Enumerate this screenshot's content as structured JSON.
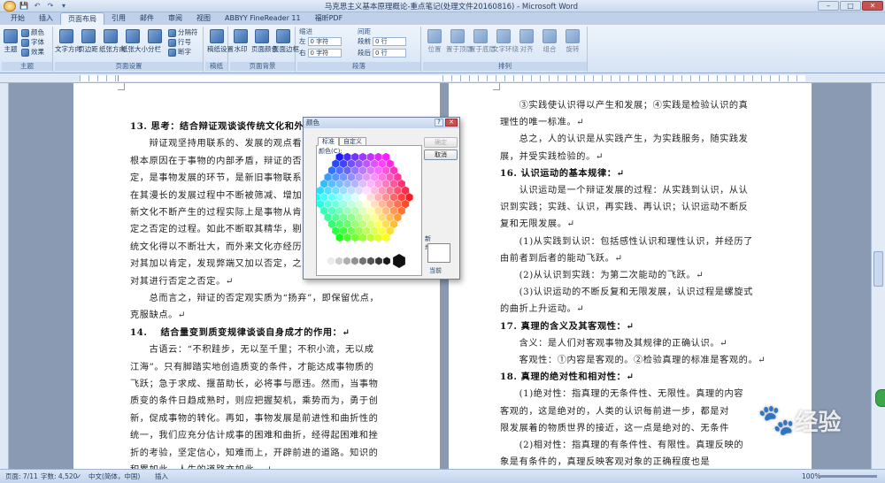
{
  "window": {
    "title": "马克思主义基本原理概论-重点笔记(处理文件20160816) - Microsoft Word",
    "min": "–",
    "max": "□",
    "close": "✕"
  },
  "tabs": [
    "开始",
    "插入",
    "页面布局",
    "引用",
    "邮件",
    "审阅",
    "视图",
    "ABBYY FineReader 11",
    "福昕PDF"
  ],
  "active_tab": "页面布局",
  "ribbon": {
    "theme": {
      "main": "主题",
      "colors": "颜色",
      "fonts": "字体",
      "effects": "效果",
      "label": "主题"
    },
    "page_setup": {
      "items": [
        "文字方向",
        "页边距",
        "纸张方向",
        "纸张大小",
        "分栏"
      ],
      "breaks": "分隔符",
      "line_numbers": "行号",
      "hyphenation": "断字",
      "label": "页面设置"
    },
    "manuscript": {
      "item": "稿纸设置",
      "label": "稿纸"
    },
    "background": {
      "items": [
        "水印",
        "页面颜色",
        "页面边框"
      ],
      "label": "页面背景"
    },
    "paragraph": {
      "indent": "缩进",
      "spacing": "间距",
      "left": "左",
      "right": "右",
      "before": "段前",
      "after": "段后",
      "left_val": "0 字符",
      "right_val": "0 字符",
      "before_val": "0 行",
      "after_val": "0 行",
      "label": "段落"
    },
    "arrange": {
      "items": [
        "位置",
        "置于顶层",
        "置于底层",
        "文字环绕",
        "对齐",
        "组合",
        "旋转"
      ],
      "label": "排列"
    }
  },
  "page1_lines": [
    {
      "t": "13. 思考：结合辩证观谈谈传统文化和外",
      "b": true
    },
    {
      "t": "　　辩证观坚持用联系的、发展的观点看",
      "b": false
    },
    {
      "t": "根本原因在于事物的内部矛盾，辩证的否",
      "b": false
    },
    {
      "t": "定，是事物发展的环节，是新旧事物联系",
      "b": false
    },
    {
      "t": "在其漫长的发展过程中不断被筛减、增加",
      "b": false
    },
    {
      "t": "新文化不断产生的过程实际上是事物从肯",
      "b": false
    },
    {
      "t": "定之否定的过程。如此不断取其精华，剔",
      "b": false
    },
    {
      "t": "统文化得以不断壮大，而外来文化亦经历",
      "b": false
    },
    {
      "t": "对其加以肯定，发现弊端又加以否定，之",
      "b": false
    },
    {
      "t": "对其进行否定之否定。↵",
      "b": false
    },
    {
      "t": "　　总而言之，辩证的否定观实质为“扬弃”，即保留优点，",
      "b": false
    },
    {
      "t": "克服缺点。↵",
      "b": false
    },
    {
      "t": "14.　 结合量变到质变规律谈谈自身成才的作用：↵",
      "b": true
    },
    {
      "t": "　　古语云：“不积跬步，无以至千里；不积小流，无以成",
      "b": false
    },
    {
      "t": "江海”。只有脚踏实地创造质变的条件，才能达成事物质的",
      "b": false
    },
    {
      "t": "飞跃；急于求成、揠苗助长，必将事与愿违。然而，当事物",
      "b": false
    },
    {
      "t": "质变的条件日趋成熟时，则应把握契机，乘势而为，勇于创",
      "b": false
    },
    {
      "t": "新，促成事物的转化。再如，事物发展是前进性和曲折性的",
      "b": false
    },
    {
      "t": "统一，我们应充分估计成事的困难和曲折，经得起困难和挫",
      "b": false
    },
    {
      "t": "折的考验，坚定信心，知难而上，开辟前进的道路。知识的",
      "b": false
    },
    {
      "t": "积累如此，人生的道路亦如此。↵",
      "b": false
    }
  ],
  "page2_lines": [
    {
      "t": "　　③实践使认识得以产生和发展；④实践是检验认识的真",
      "b": false
    },
    {
      "t": "理性的唯一标准。↵",
      "b": false
    },
    {
      "t": "　　总之，人的认识是从实践产生，为实践服务，随实践发",
      "b": false
    },
    {
      "t": "展，并受实践检验的。↵",
      "b": false
    },
    {
      "t": "16. 认识运动的基本规律：↵",
      "b": true
    },
    {
      "t": "　　认识运动是一个辩证发展的过程：从实践到认识，从认",
      "b": false
    },
    {
      "t": "识到实践；实践、认识，再实践、再认识；认识运动不断反",
      "b": false
    },
    {
      "t": "复和无限发展。↵",
      "b": false
    },
    {
      "t": "　　(1)从实践到认识：包括感性认识和理性认识，并经历了",
      "b": false
    },
    {
      "t": "由前者到后者的能动飞跃。↵",
      "b": false
    },
    {
      "t": "　　(2)从认识到实践：为第二次能动的飞跃。↵",
      "b": false
    },
    {
      "t": "　　(3)认识运动的不断反复和无限发展，认识过程是螺旋式",
      "b": false
    },
    {
      "t": "的曲折上升运动。↵",
      "b": false
    },
    {
      "t": "17. 真理的含义及其客观性：↵",
      "b": true
    },
    {
      "t": "　　含义：是人们对客观事物及其规律的正确认识。↵",
      "b": false
    },
    {
      "t": "　　客观性：①内容是客观的。②检验真理的标准是客观的。↵",
      "b": false
    },
    {
      "t": "18. 真理的绝对性和相对性：↵",
      "b": true
    },
    {
      "t": "　　(1)绝对性：指真理的无条件性、无限性。真理的内容",
      "b": false
    },
    {
      "t": "客观的，这是绝对的，人类的认识每前进一步，都是对",
      "b": false
    },
    {
      "t": "限发展着的物质世界的接近，这一点是绝对的、无条件",
      "b": false
    },
    {
      "t": "　　(2)相对性：指真理的有条件性、有限性。真理反映的",
      "b": false
    },
    {
      "t": "象是有条件的，真理反映客观对象的正确程度也是",
      "b": false
    }
  ],
  "dialog": {
    "title": "颜色",
    "help": "?",
    "close": "✕",
    "tab_standard": "标准",
    "tab_custom": "自定义",
    "colors_label": "颜色(C):",
    "ok": "确定",
    "cancel": "取消",
    "new_label": "新增",
    "current_label": "当前"
  },
  "status": {
    "page": "页面: 7/11",
    "words": "字数: 4,520",
    "lang": "中文(简体，中国)",
    "mode": "插入",
    "zoom": "100%"
  },
  "watermark": "经验"
}
